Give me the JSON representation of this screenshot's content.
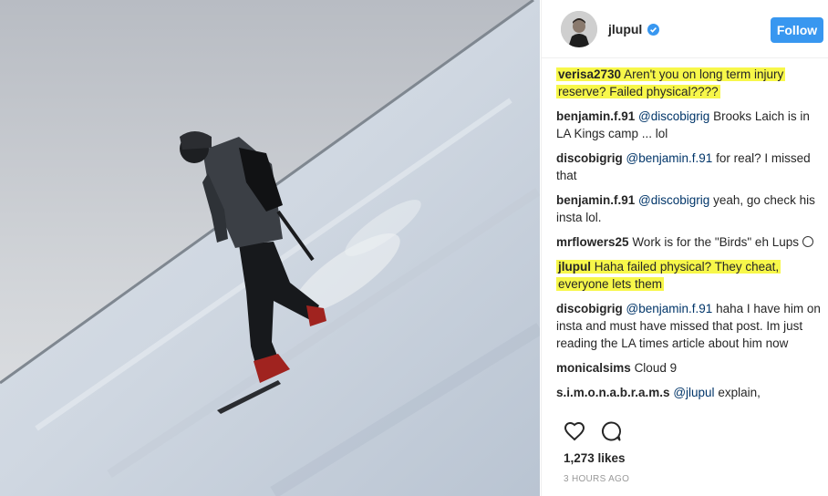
{
  "post": {
    "username": "jlupul",
    "follow_label": "Follow",
    "likes": "1,273 likes",
    "time": "3 HOURS AGO"
  },
  "comments": [
    {
      "user": "verisa2730",
      "mention": "",
      "text": "Aren't you on long term injury reserve? Failed physical????",
      "highlighted": true
    },
    {
      "user": "benjamin.f.91",
      "mention": "@discobigrig",
      "text": "Brooks Laich is in LA Kings camp ... lol",
      "highlighted": false
    },
    {
      "user": "discobigrig",
      "mention": "@benjamin.f.91",
      "text": "for real? I missed that",
      "highlighted": false
    },
    {
      "user": "benjamin.f.91",
      "mention": "@discobigrig",
      "text": "yeah, go check his insta lol.",
      "highlighted": false
    },
    {
      "user": "mrflowers25",
      "mention": "",
      "text": "Work is for the \"Birds\" eh Lups",
      "highlighted": false,
      "emoji": "smile-emoji"
    },
    {
      "user": "jlupul",
      "mention": "",
      "text": "Haha failed physical? They cheat, everyone lets them",
      "highlighted": true
    },
    {
      "user": "discobigrig",
      "mention": "@benjamin.f.91",
      "text": "haha I have him on insta and must have missed that post. Im just reading the LA times article about him now",
      "highlighted": false
    },
    {
      "user": "monicalsims",
      "mention": "",
      "text": "Cloud 9",
      "highlighted": false
    },
    {
      "user": "s.i.m.o.n.a.b.r.a.m.s",
      "mention": "@jlupul",
      "text": "explain,",
      "highlighted": false
    }
  ],
  "icons": {
    "verified": "verified-badge-icon",
    "like": "heart-icon",
    "comment": "comment-bubble-icon"
  },
  "colors": {
    "follow_button": "#3897f0",
    "highlight": "#f7f74a",
    "verified": "#3897f0"
  }
}
